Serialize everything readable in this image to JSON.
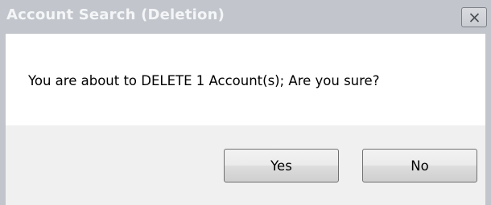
{
  "window": {
    "title": "Account Search (Deletion)",
    "close_icon": "close-icon"
  },
  "message": {
    "text": "You are about to DELETE 1 Account(s); Are you sure?"
  },
  "buttons": {
    "yes_label": "Yes",
    "no_label": "No"
  },
  "colors": {
    "frame": "#c2c6cc",
    "title_text": "#f4f5f7",
    "message_background": "#ffffff",
    "button_area_background": "#f0f0f0"
  }
}
